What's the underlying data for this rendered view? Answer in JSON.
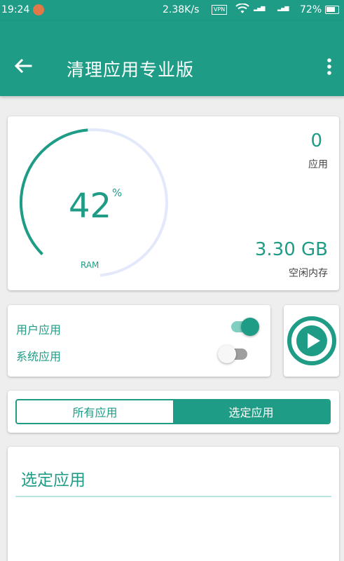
{
  "status_bar": {
    "time": "19:24",
    "net_speed": "2.38K/s",
    "vpn": "VPN",
    "battery": "72%"
  },
  "app_bar": {
    "title": "清理应用专业版",
    "back_icon": "arrow-left-icon",
    "menu_icon": "more-vert-icon"
  },
  "ram": {
    "percent": 42,
    "percent_text": "42",
    "percent_sign": "%",
    "label": "RAM",
    "apps_count": "0",
    "apps_label": "应用",
    "free_memory": "3.30 GB",
    "free_memory_label": "空闲内存"
  },
  "toggles": {
    "user_apps": {
      "label": "用户应用",
      "on": true
    },
    "system_apps": {
      "label": "系统应用",
      "on": false
    }
  },
  "play_icon": "play-circle-icon",
  "tabs": [
    {
      "label": "所有应用",
      "active": false
    },
    {
      "label": "选定应用",
      "active": true
    }
  ],
  "selected_section": {
    "title": "选定应用"
  },
  "colors": {
    "accent": "#1e9c86",
    "gauge_track": "#e3e8fa",
    "background": "#eeeeee"
  }
}
